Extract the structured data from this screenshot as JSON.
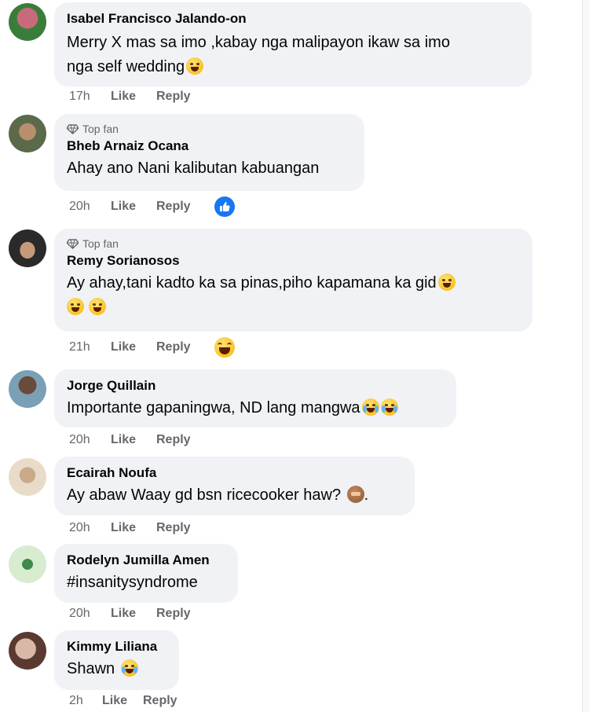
{
  "comments": [
    {
      "name": "Isabel Francisco Jalando-on",
      "text_line1": "Merry X mas sa imo ,kabay nga malipayon ikaw sa imo",
      "text_line2": "nga self wedding",
      "time": "17h",
      "like": "Like",
      "reply": "Reply",
      "avatar_colors": [
        "#3a7d3a",
        "#c76b7a"
      ]
    },
    {
      "badge": "Top fan",
      "name": "Bheb Arnaiz Ocana",
      "text_line1": "Ahay ano Nani kalibutan kabuangan",
      "time": "20h",
      "like": "Like",
      "reply": "Reply",
      "reaction": "like",
      "avatar_colors": [
        "#5a6a4a",
        "#b88f6e"
      ]
    },
    {
      "badge": "Top fan",
      "name": "Remy Sorianosos",
      "text_line1": "Ay ahay,tani kadto ka sa pinas,piho kapamana ka gid",
      "time": "21h",
      "like": "Like",
      "reply": "Reply",
      "reaction": "haha",
      "avatar_colors": [
        "#2a2a2a",
        "#c49a7a"
      ]
    },
    {
      "name": "Jorge Quillain",
      "text_line1": "Importante gapaningwa, ND lang mangwa",
      "time": "20h",
      "like": "Like",
      "reply": "Reply",
      "avatar_colors": [
        "#7aa0b5",
        "#6a4a3a"
      ]
    },
    {
      "name": "Ecairah Noufa",
      "text_line1": "Ay abaw Waay gd bsn ricecooker haw?",
      "text_suffix": ".",
      "time": "20h",
      "like": "Like",
      "reply": "Reply",
      "avatar_colors": [
        "#e8dcc8",
        "#c9a98a"
      ]
    },
    {
      "name": "Rodelyn Jumilla Amen",
      "text_line1": "#insanitysyndrome",
      "time": "20h",
      "like": "Like",
      "reply": "Reply",
      "avatar_colors": [
        "#d8ecd0",
        "#3f8a4a"
      ]
    },
    {
      "name": "Kimmy Liliana",
      "text_line1": "Shawn",
      "time": "2h",
      "like": "Like",
      "reply": "Reply",
      "avatar_colors": [
        "#d9b8a8",
        "#5a3a30"
      ]
    }
  ],
  "colors": {
    "bubble": "#f0f2f5",
    "meta": "#65676b",
    "like_blue": "#1877f2"
  },
  "icons": {
    "badge": "diamond-icon",
    "like_reaction": "thumbs-up-icon",
    "haha_reaction": "laughing-face-icon"
  }
}
